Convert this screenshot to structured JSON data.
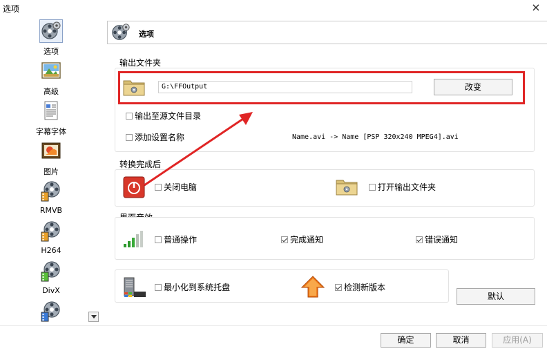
{
  "window": {
    "title": "选项",
    "close_glyph": "×"
  },
  "sidebar": {
    "items": [
      {
        "label": "选项",
        "icon": "film-reel-gear-icon",
        "selected": true
      },
      {
        "label": "高级",
        "icon": "landscape-picture-icon"
      },
      {
        "label": "字幕字体",
        "icon": "text-document-icon"
      },
      {
        "label": "图片",
        "icon": "photo-frame-icon"
      },
      {
        "label": "RMVB",
        "icon": "film-reel-icon"
      },
      {
        "label": "H264",
        "icon": "film-reel-icon"
      },
      {
        "label": "DivX",
        "icon": "film-reel-icon"
      },
      {
        "label": "",
        "icon": "film-reel-icon"
      }
    ]
  },
  "header": {
    "title": "选项"
  },
  "output_folder": {
    "group_title": "输出文件夹",
    "path": "G:\\FFOutput",
    "change_label": "改变",
    "output_to_source_label": "输出至源文件目录",
    "add_setting_name_label": "添加设置名称",
    "name_example": "Name.avi  -> Name [PSP 320x240 MPEG4].avi"
  },
  "after_convert": {
    "group_title": "转换完成后",
    "shutdown_label": "关闭电脑",
    "open_folder_label": "打开输出文件夹"
  },
  "sound": {
    "group_title": "界面音效",
    "normal_op_label": "普通操作",
    "normal_op_checked": false,
    "complete_label": "完成通知",
    "complete_checked": true,
    "error_label": "错误通知",
    "error_checked": true
  },
  "misc": {
    "minimize_tray_label": "最小化到系统托盘",
    "minimize_tray_checked": false,
    "check_update_label": "检测新版本",
    "check_update_checked": true
  },
  "buttons": {
    "default_label": "默认",
    "ok_label": "确定",
    "cancel_label": "取消",
    "apply_label": "应用(A)"
  },
  "colors": {
    "highlight_red": "#e02525",
    "arrow_red": "#e02525",
    "update_arrow": "#f07a1a",
    "power_red": "#d8372a"
  }
}
